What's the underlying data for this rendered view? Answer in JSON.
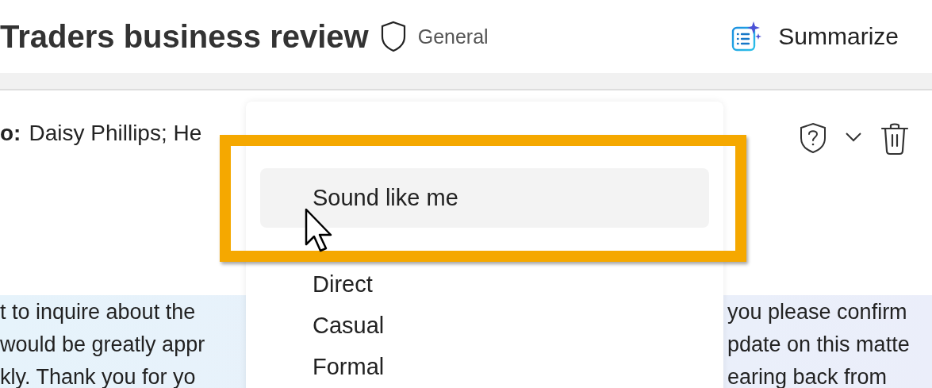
{
  "header": {
    "title": "Traders business review",
    "sensitivity": "General",
    "summarize": "Summarize"
  },
  "recipients": {
    "label": "o:",
    "value": "Daisy Phillips; He"
  },
  "body_left": [
    "t to inquire about the",
    "would be greatly appr",
    "kly. Thank you for yo"
  ],
  "body_right": [
    "you please confirm",
    "pdate on this matte",
    "earing back from"
  ],
  "tone_menu": {
    "items": [
      {
        "label": "Sound like me",
        "selected": true
      },
      {
        "label": "Direct",
        "selected": false
      },
      {
        "label": "Casual",
        "selected": false
      },
      {
        "label": "Formal",
        "selected": false
      }
    ]
  }
}
